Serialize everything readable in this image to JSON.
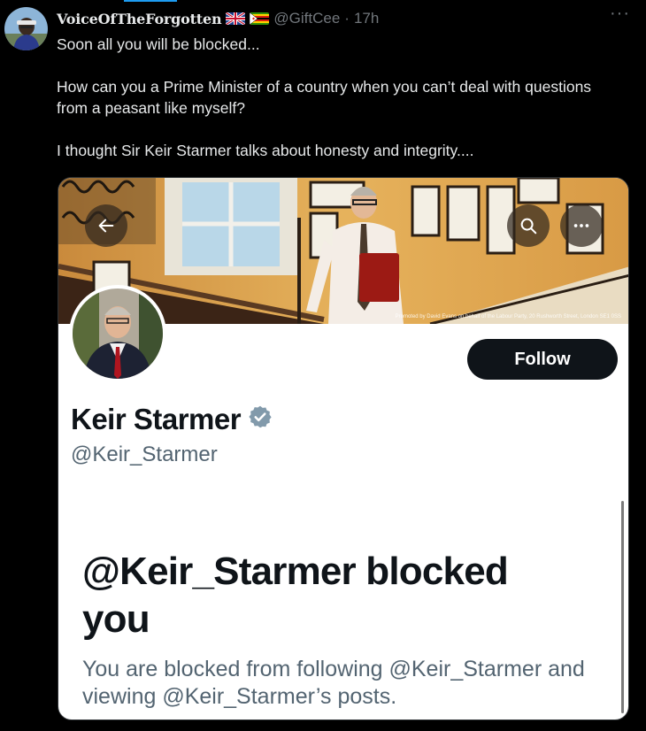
{
  "tweet": {
    "author_name": "VoiceOfTheForgotten",
    "handle": "@GiftCee",
    "separator": "·",
    "time": "17h",
    "more_label": "···",
    "text_lines": [
      "Soon all you will be blocked...",
      "How can you a Prime Minister of a country when you can’t deal with questions from a peasant like myself?",
      "I thought Sir Keir Starmer talks about honesty and integrity...."
    ]
  },
  "card": {
    "promo_text": "Promoted by David Evans on behalf of the Labour Party, 20 Rushworth Street, London SE1 0SS",
    "follow_label": "Follow",
    "profile_name": "Keir Starmer",
    "profile_handle": "@Keir_Starmer",
    "blocked_title": "@Keir_Starmer blocked you",
    "blocked_desc": "You are blocked from following @Keir_Starmer and viewing @Keir_Starmer’s posts.",
    "icons": [
      "back-arrow-icon",
      "search-icon",
      "more-icon",
      "verified-badge-icon"
    ]
  },
  "colors": {
    "background": "#000000",
    "text_primary": "#e7e9ea",
    "text_secondary": "#71767b",
    "card_bg": "#ffffff",
    "card_text": "#0f1419",
    "card_secondary": "#536471",
    "follow_bg": "#0f1419",
    "verified": "#829aab"
  }
}
